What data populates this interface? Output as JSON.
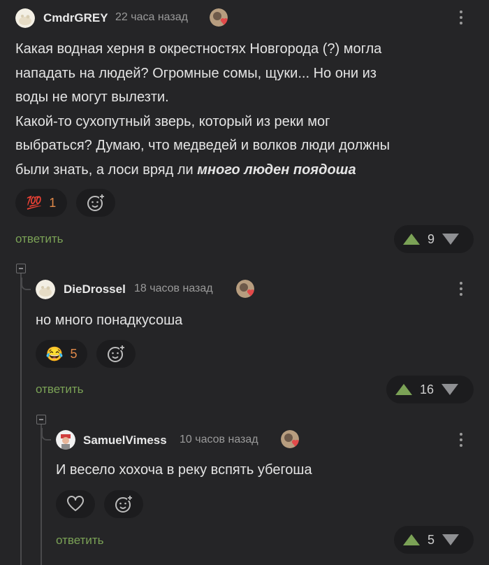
{
  "comments": [
    {
      "username": "CmdrGREY",
      "timestamp": "22 часа назад",
      "text_lines": [
        "Какая водная херня в окрестностях Новгорода (?) могла",
        "нападать на людей? Огромные сомы, щуки... Но они из",
        "воды не могут вылезти.",
        "Какой-то сухопутный зверь, который из реки мог",
        "выбраться? Думаю, что медведей и волков люди должны"
      ],
      "text_last_plain": "были знать, а лоси вряд ли ",
      "text_last_emph": "много люден поядоша",
      "reaction_emoji": "💯",
      "reaction_count": "1",
      "reply_label": "ответить",
      "rating": "9"
    },
    {
      "username": "DieDrossel",
      "timestamp": "18 часов назад",
      "text": "но много понадкусоша",
      "reaction_emoji": "😂",
      "reaction_count": "5",
      "reply_label": "ответить",
      "rating": "16"
    },
    {
      "username": "SamuelVimess",
      "timestamp": "10 часов назад",
      "text": "И весело хохоча в реку вспять убегоша",
      "reply_label": "ответить",
      "rating": "5"
    }
  ],
  "colors": {
    "upvote": "#7ba256",
    "downvote": "#8f9093",
    "reply": "#7ba256",
    "reaction_count": "#e0894a"
  },
  "icons": [
    "kebab-menu-icon",
    "add-reaction-icon",
    "heart-icon",
    "upvote-icon",
    "downvote-icon",
    "collapse-icon"
  ]
}
